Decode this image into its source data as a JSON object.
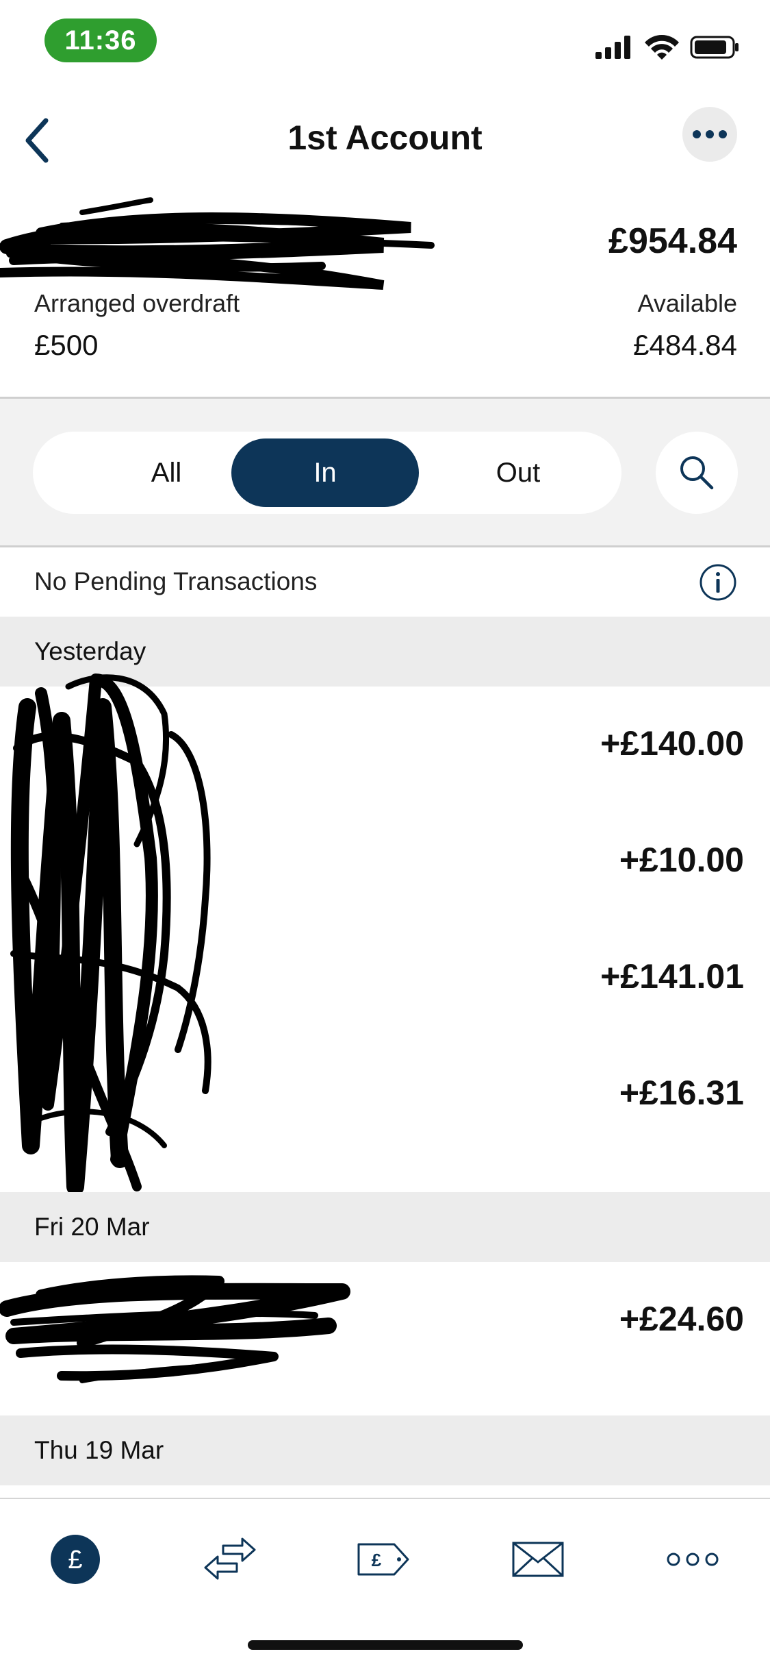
{
  "status_bar": {
    "time": "11:36"
  },
  "header": {
    "title": "1st Account"
  },
  "account": {
    "balance": "£954.84",
    "overdraft_label": "Arranged overdraft",
    "overdraft_value": "£500",
    "available_label": "Available",
    "available_value": "£484.84"
  },
  "filter": {
    "tabs": [
      "All",
      "In",
      "Out"
    ],
    "selected": "In"
  },
  "pending": {
    "text": "No Pending Transactions"
  },
  "sections": [
    {
      "label": "Yesterday",
      "transactions": [
        {
          "amount": "+£140.00"
        },
        {
          "amount": "+£10.00"
        },
        {
          "amount": "+£141.01"
        },
        {
          "amount": "+£16.31"
        }
      ]
    },
    {
      "label": "Fri 20 Mar",
      "transactions": [
        {
          "amount": "+£24.60"
        }
      ]
    },
    {
      "label": "Thu 19 Mar",
      "transactions": []
    }
  ],
  "colors": {
    "accent": "#0d3558",
    "time_pill": "#2f9e2f",
    "section_bg": "#ececec",
    "filter_bg": "#f2f2f2"
  },
  "tab_bar": {
    "items": [
      {
        "icon": "pound-icon",
        "selected": true
      },
      {
        "icon": "transfer-arrows-icon",
        "selected": false
      },
      {
        "icon": "price-tag-icon",
        "selected": false
      },
      {
        "icon": "envelope-icon",
        "selected": false
      },
      {
        "icon": "more-dots-icon",
        "selected": false
      }
    ]
  }
}
